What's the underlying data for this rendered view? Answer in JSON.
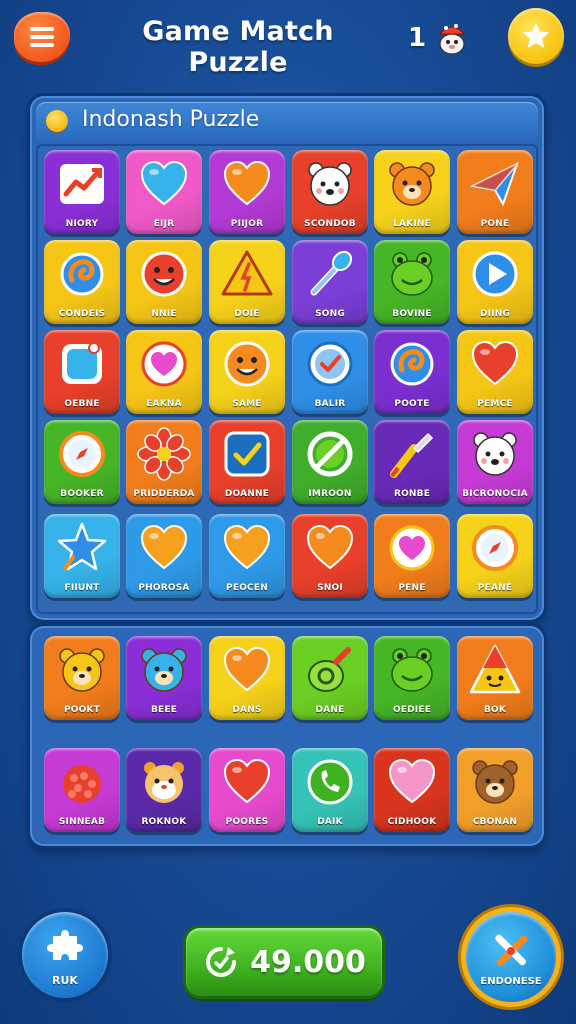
{
  "header": {
    "title": "Game Match Puzzle",
    "counter": "1",
    "menu_icon": "hamburger-menu-icon",
    "star_icon": "star-icon",
    "mascot_icon": "mascot-icon"
  },
  "panel": {
    "title": "Indonash Puzzle",
    "rows": [
      [
        {
          "label": "NIORY",
          "color": "#8a2fd8",
          "icon": "trend-chart-icon"
        },
        {
          "label": "EIJR",
          "color": "#f05ac8",
          "icon": "heart-icon"
        },
        {
          "label": "PIIJOR",
          "color": "#b43ad6",
          "icon": "heart-icon"
        },
        {
          "label": "SCONDOB",
          "color": "#e8402a",
          "icon": "polar-bear-icon"
        },
        {
          "label": "LAKINE",
          "color": "#f6d21a",
          "icon": "bear-icon"
        },
        {
          "label": "PONE",
          "color": "#f27d1c",
          "icon": "paper-plane-icon"
        }
      ],
      [
        {
          "label": "CONDEIS",
          "color": "#f6c616",
          "icon": "swirl-icon"
        },
        {
          "label": "NNIE",
          "color": "#f6c616",
          "icon": "smiley-face-icon"
        },
        {
          "label": "DOIE",
          "color": "#f6d21a",
          "icon": "warning-triangle-icon"
        },
        {
          "label": "SONG",
          "color": "#7b3fd8",
          "icon": "wand-icon"
        },
        {
          "label": "BOVINE",
          "color": "#46b526",
          "icon": "frog-icon"
        },
        {
          "label": "DIING",
          "color": "#f6c616",
          "icon": "play-icon"
        }
      ],
      [
        {
          "label": "OEBNE",
          "color": "#e8402a",
          "icon": "square-badge-icon"
        },
        {
          "label": "EAKNA",
          "color": "#f6c616",
          "icon": "heart-circle-icon"
        },
        {
          "label": "SAME",
          "color": "#f6d21a",
          "icon": "smiley-face-icon"
        },
        {
          "label": "BALIR",
          "color": "#2f8fe8",
          "icon": "check-circle-icon"
        },
        {
          "label": "POOTE",
          "color": "#7b2fd0",
          "icon": "swirl-icon"
        },
        {
          "label": "PEMCE",
          "color": "#f6c616",
          "icon": "heart-icon"
        }
      ],
      [
        {
          "label": "BOOKER",
          "color": "#46b526",
          "icon": "compass-icon"
        },
        {
          "label": "PRIDDERDA",
          "color": "#f27d1c",
          "icon": "flower-icon"
        },
        {
          "label": "DOANNE",
          "color": "#e8402a",
          "icon": "check-square-icon"
        },
        {
          "label": "IMROON",
          "color": "#3fae2a",
          "icon": "crossed-circle-icon"
        },
        {
          "label": "RONBE",
          "color": "#6a2ab8",
          "icon": "brush-icon"
        },
        {
          "label": "BICRONOCIA",
          "color": "#c63ad6",
          "icon": "polar-bear-icon"
        }
      ],
      [
        {
          "label": "FIIUNT",
          "color": "#36b3ea",
          "icon": "star-icon"
        },
        {
          "label": "PHOROSA",
          "color": "#2f9ae8",
          "icon": "heart-icon"
        },
        {
          "label": "PEOCEN",
          "color": "#2f9ae8",
          "icon": "heart-icon"
        },
        {
          "label": "SNOI",
          "color": "#e8402a",
          "icon": "heart-icon"
        },
        {
          "label": "PENE",
          "color": "#f27d1c",
          "icon": "heart-circle-icon"
        },
        {
          "label": "PEANE",
          "color": "#f6d21a",
          "icon": "compass-icon"
        }
      ]
    ]
  },
  "panel2": {
    "rows": [
      [
        {
          "label": "POOKT",
          "color": "#f27d1c",
          "icon": "bear-icon"
        },
        {
          "label": "BEEE",
          "color": "#8a2fd8",
          "icon": "bear-icon"
        },
        {
          "label": "DANS",
          "color": "#f6d21a",
          "icon": "heart-icon"
        },
        {
          "label": "DANE",
          "color": "#6ccf24",
          "icon": "potion-icon"
        },
        {
          "label": "OEDIEE",
          "color": "#46b526",
          "icon": "frog-icon"
        },
        {
          "label": "BOK",
          "color": "#f27d1c",
          "icon": "triangle-face-icon"
        }
      ],
      [
        {
          "label": "SINNEAB",
          "color": "#c63ad6",
          "icon": "raspberry-icon"
        },
        {
          "label": "ROKNOK",
          "color": "#5a2aa8",
          "icon": "hamster-icon"
        },
        {
          "label": "POORES",
          "color": "#e84acd",
          "icon": "heart-icon"
        },
        {
          "label": "DAIK",
          "color": "#36c3b8",
          "icon": "phone-icon"
        },
        {
          "label": "CIDHOOK",
          "color": "#d8341e",
          "icon": "heart-icon"
        },
        {
          "label": "CBONAN",
          "color": "#f2a02a",
          "icon": "bear-icon"
        }
      ]
    ]
  },
  "footer": {
    "left_label": "RUK",
    "left_icon": "puzzle-piece-icon",
    "score": "49.000",
    "score_icon": "refresh-icon",
    "right_label": "ENDONESE",
    "right_icon": "crossed-tools-icon"
  }
}
